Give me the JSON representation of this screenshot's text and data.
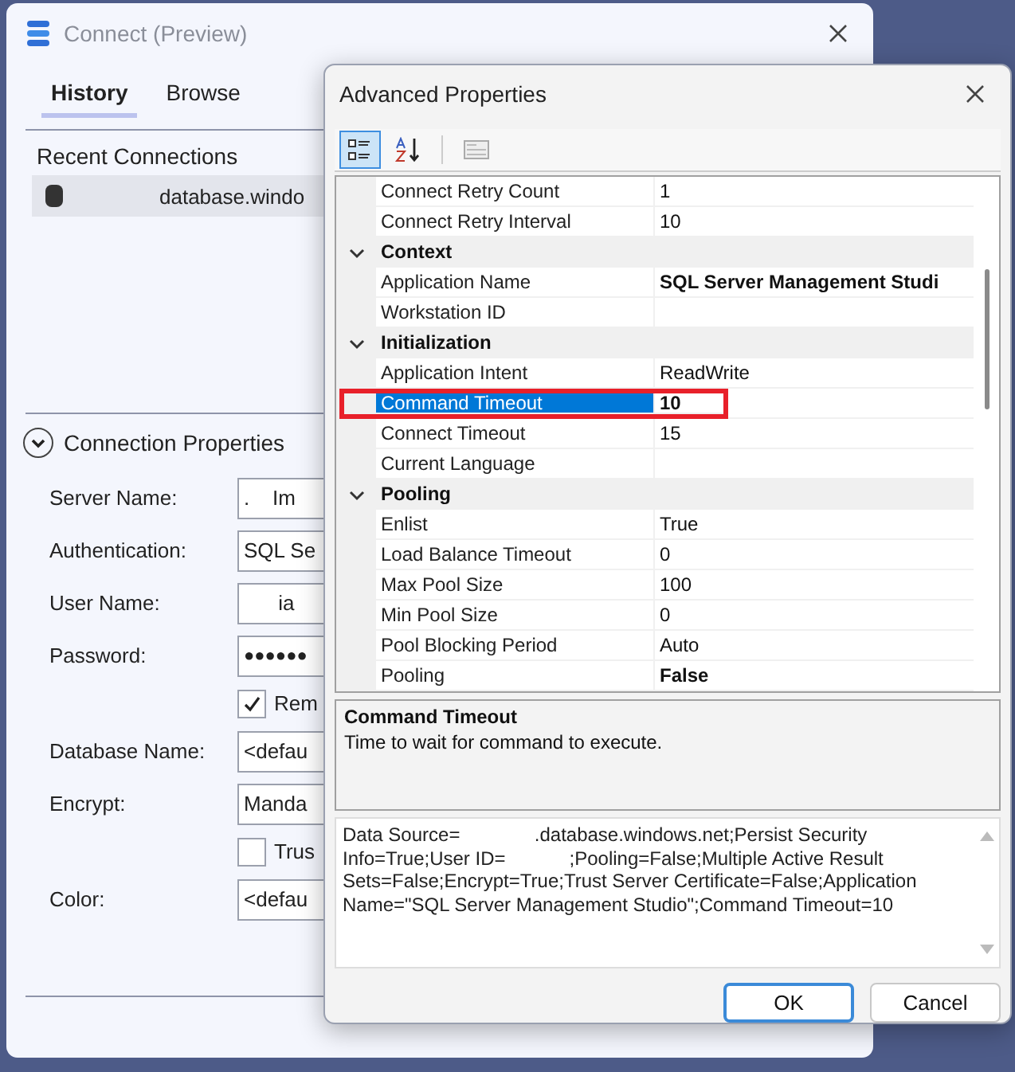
{
  "connect_window": {
    "title": "Connect (Preview)",
    "tabs": [
      {
        "label": "History",
        "selected": true
      },
      {
        "label": "Browse",
        "selected": false
      }
    ],
    "recent_connections": {
      "heading": "Recent Connections",
      "items": [
        {
          "label": "database.windo",
          "selected": true
        }
      ]
    },
    "connection_properties": {
      "heading": "Connection Properties",
      "expanded": true,
      "fields": [
        {
          "kind": "field",
          "label": "Server Name:",
          "value": ".    Im"
        },
        {
          "kind": "field",
          "label": "Authentication:",
          "value": "SQL Se"
        },
        {
          "kind": "field",
          "label": "User Name:",
          "value": "      ia"
        },
        {
          "kind": "password",
          "label": "Password:",
          "value": "●●●●●●"
        },
        {
          "kind": "checkbox",
          "label": "Rem",
          "checked": true
        },
        {
          "kind": "field",
          "label": "Database Name:",
          "value": "<defau"
        },
        {
          "kind": "field",
          "label": "Encrypt:",
          "value": "Manda"
        },
        {
          "kind": "checkbox",
          "label": "Trus",
          "checked": false
        },
        {
          "kind": "field",
          "label": "Color:",
          "value": "<defau"
        }
      ]
    }
  },
  "advanced_properties": {
    "title": "Advanced Properties",
    "toolbar": [
      {
        "kind": "categorized",
        "selected": true
      },
      {
        "kind": "alphabetical",
        "selected": false
      },
      {
        "kind": "property_pages",
        "selected": false
      }
    ],
    "rows": [
      {
        "kind": "property",
        "name": "Connect Retry Count",
        "value": "1",
        "modified": false,
        "selected": false,
        "highlighted": false
      },
      {
        "kind": "property",
        "name": "Connect Retry Interval",
        "value": "10",
        "modified": false,
        "selected": false,
        "highlighted": false
      },
      {
        "kind": "category",
        "label": "Context",
        "expanded": true
      },
      {
        "kind": "property",
        "name": "Application Name",
        "value": "SQL Server Management Studi",
        "modified": true,
        "selected": false,
        "highlighted": false
      },
      {
        "kind": "property",
        "name": "Workstation ID",
        "selected": false,
        "highlighted": false
      },
      {
        "kind": "category",
        "label": "Initialization",
        "expanded": true
      },
      {
        "kind": "property",
        "name": "Application Intent",
        "value": "ReadWrite",
        "modified": false,
        "selected": false,
        "highlighted": false
      },
      {
        "kind": "property",
        "name": "Command Timeout",
        "value": "10",
        "modified": true,
        "selected": true,
        "highlighted": true
      },
      {
        "kind": "property",
        "name": "Connect Timeout",
        "value": "15",
        "modified": false,
        "selected": false,
        "highlighted": false
      },
      {
        "kind": "property",
        "name": "Current Language",
        "selected": false,
        "highlighted": false
      },
      {
        "kind": "category",
        "label": "Pooling",
        "expanded": true
      },
      {
        "kind": "property",
        "name": "Enlist",
        "value": "True",
        "modified": false,
        "selected": false,
        "highlighted": false
      },
      {
        "kind": "property",
        "name": "Load Balance Timeout",
        "value": "0",
        "modified": false,
        "selected": false,
        "highlighted": false
      },
      {
        "kind": "property",
        "name": "Max Pool Size",
        "value": "100",
        "modified": false,
        "selected": false,
        "highlighted": false
      },
      {
        "kind": "property",
        "name": "Min Pool Size",
        "value": "0",
        "modified": false,
        "selected": false,
        "highlighted": false
      },
      {
        "kind": "property",
        "name": "Pool Blocking Period",
        "value": "Auto",
        "modified": false,
        "selected": false,
        "highlighted": false
      },
      {
        "kind": "property",
        "name": "Pooling",
        "value": "False",
        "modified": true,
        "selected": false,
        "highlighted": false
      }
    ],
    "description": {
      "title": "Command Timeout",
      "text": "Time to wait for command to execute."
    },
    "connection_string": "Data Source=              .database.windows.net;Persist Security Info=True;User ID=            ;Pooling=False;Multiple Active Result Sets=False;Encrypt=True;Trust Server Certificate=False;Application Name=\"SQL Server Management Studio\";Command Timeout=10",
    "buttons": [
      {
        "label": "OK",
        "default": true
      },
      {
        "label": "Cancel",
        "default": false
      }
    ]
  }
}
